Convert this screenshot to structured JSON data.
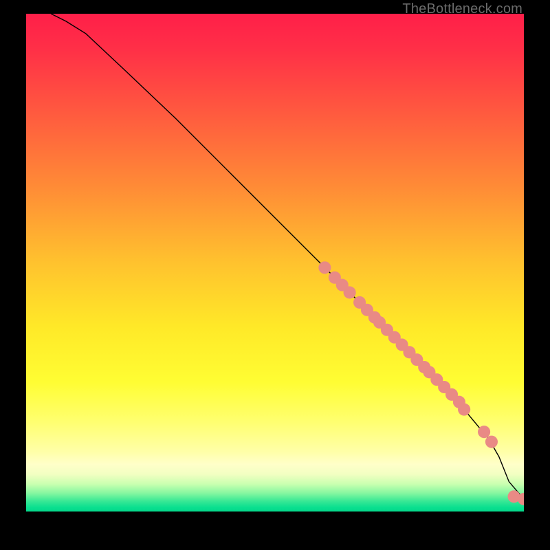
{
  "watermark": "TheBottleneck.com",
  "dot_color": "#e98a85",
  "curve_color": "#000000",
  "chart_data": {
    "type": "line",
    "title": "",
    "xlabel": "",
    "ylabel": "",
    "xlim": [
      0,
      100
    ],
    "ylim": [
      0,
      100
    ],
    "grid": false,
    "series": [
      {
        "name": "curve",
        "x": [
          5,
          8,
          12,
          20,
          30,
          40,
          50,
          60,
          70,
          80,
          88,
          93,
          95,
          97,
          100
        ],
        "y": [
          100,
          98.5,
          96,
          88.5,
          79,
          69,
          59,
          49,
          39,
          29,
          20.5,
          14.5,
          11,
          6,
          2.5
        ]
      },
      {
        "name": "dots",
        "x": [
          60,
          62,
          63.5,
          65,
          67,
          68.5,
          70,
          71,
          72.5,
          74,
          75.5,
          77,
          78.5,
          80,
          81,
          82.5,
          84,
          85.5,
          87,
          88,
          92,
          93.5,
          98,
          100
        ],
        "y": [
          49,
          47,
          45.5,
          44,
          42,
          40.5,
          39,
          38,
          36.5,
          35,
          33.5,
          32,
          30.5,
          29,
          28,
          26.5,
          25,
          23.5,
          22,
          20.5,
          16,
          14,
          3,
          2.5
        ]
      }
    ],
    "gradient_stops": [
      {
        "offset": 0.0,
        "color": "#ff1f49"
      },
      {
        "offset": 0.07,
        "color": "#ff2f47"
      },
      {
        "offset": 0.2,
        "color": "#ff5a3f"
      },
      {
        "offset": 0.35,
        "color": "#ff8c36"
      },
      {
        "offset": 0.5,
        "color": "#ffc22e"
      },
      {
        "offset": 0.63,
        "color": "#ffe928"
      },
      {
        "offset": 0.74,
        "color": "#fffd33"
      },
      {
        "offset": 0.82,
        "color": "#ffff70"
      },
      {
        "offset": 0.88,
        "color": "#ffffa8"
      },
      {
        "offset": 0.905,
        "color": "#ffffc9"
      },
      {
        "offset": 0.925,
        "color": "#f2ffc2"
      },
      {
        "offset": 0.945,
        "color": "#c9ffb0"
      },
      {
        "offset": 0.963,
        "color": "#86f7a0"
      },
      {
        "offset": 0.978,
        "color": "#3de996"
      },
      {
        "offset": 0.992,
        "color": "#09df8f"
      },
      {
        "offset": 1.0,
        "color": "#05d98b"
      }
    ]
  }
}
